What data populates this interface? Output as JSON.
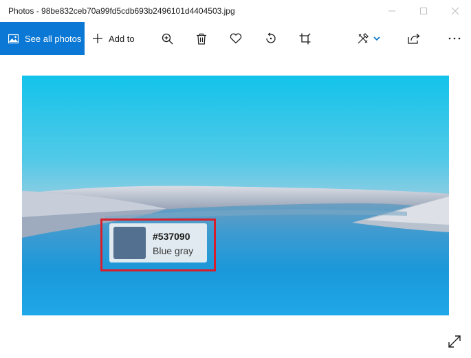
{
  "window": {
    "title": "Photos - 98be832ceb70a99fd5cdb693b2496101d4404503.jpg",
    "controls": [
      "minimize-icon",
      "maximize-icon",
      "close-icon"
    ]
  },
  "toolbar": {
    "see_all_label": "See all photos",
    "add_to_label": "Add to",
    "buttons": [
      "zoom-in-icon",
      "delete-icon",
      "favorite-icon",
      "rotate-icon",
      "crop-icon",
      "edit-icon",
      "share-icon",
      "more-icon"
    ],
    "accent": "#0a78d4"
  },
  "color_picker": {
    "hex": "#537090",
    "name": "Blue gray",
    "swatch_color": "#537090",
    "highlight_color": "#d81e2a"
  }
}
